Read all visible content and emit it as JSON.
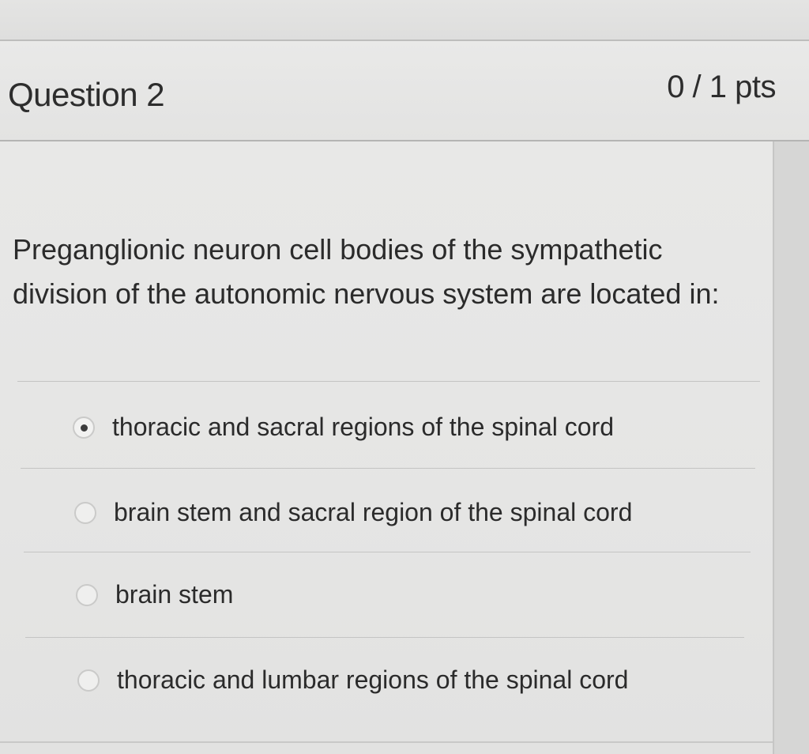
{
  "question": {
    "title": "Question 2",
    "points": "0 / 1 pts",
    "text": "Preganglionic neuron cell bodies of the sympathetic division of the autonomic nervous system are located in:",
    "answers": [
      {
        "label": "thoracic and sacral regions of the spinal cord",
        "selected": true
      },
      {
        "label": "brain stem and sacral region of the spinal cord",
        "selected": false
      },
      {
        "label": "brain stem",
        "selected": false
      },
      {
        "label": "thoracic and lumbar regions of the spinal cord",
        "selected": false
      }
    ]
  }
}
